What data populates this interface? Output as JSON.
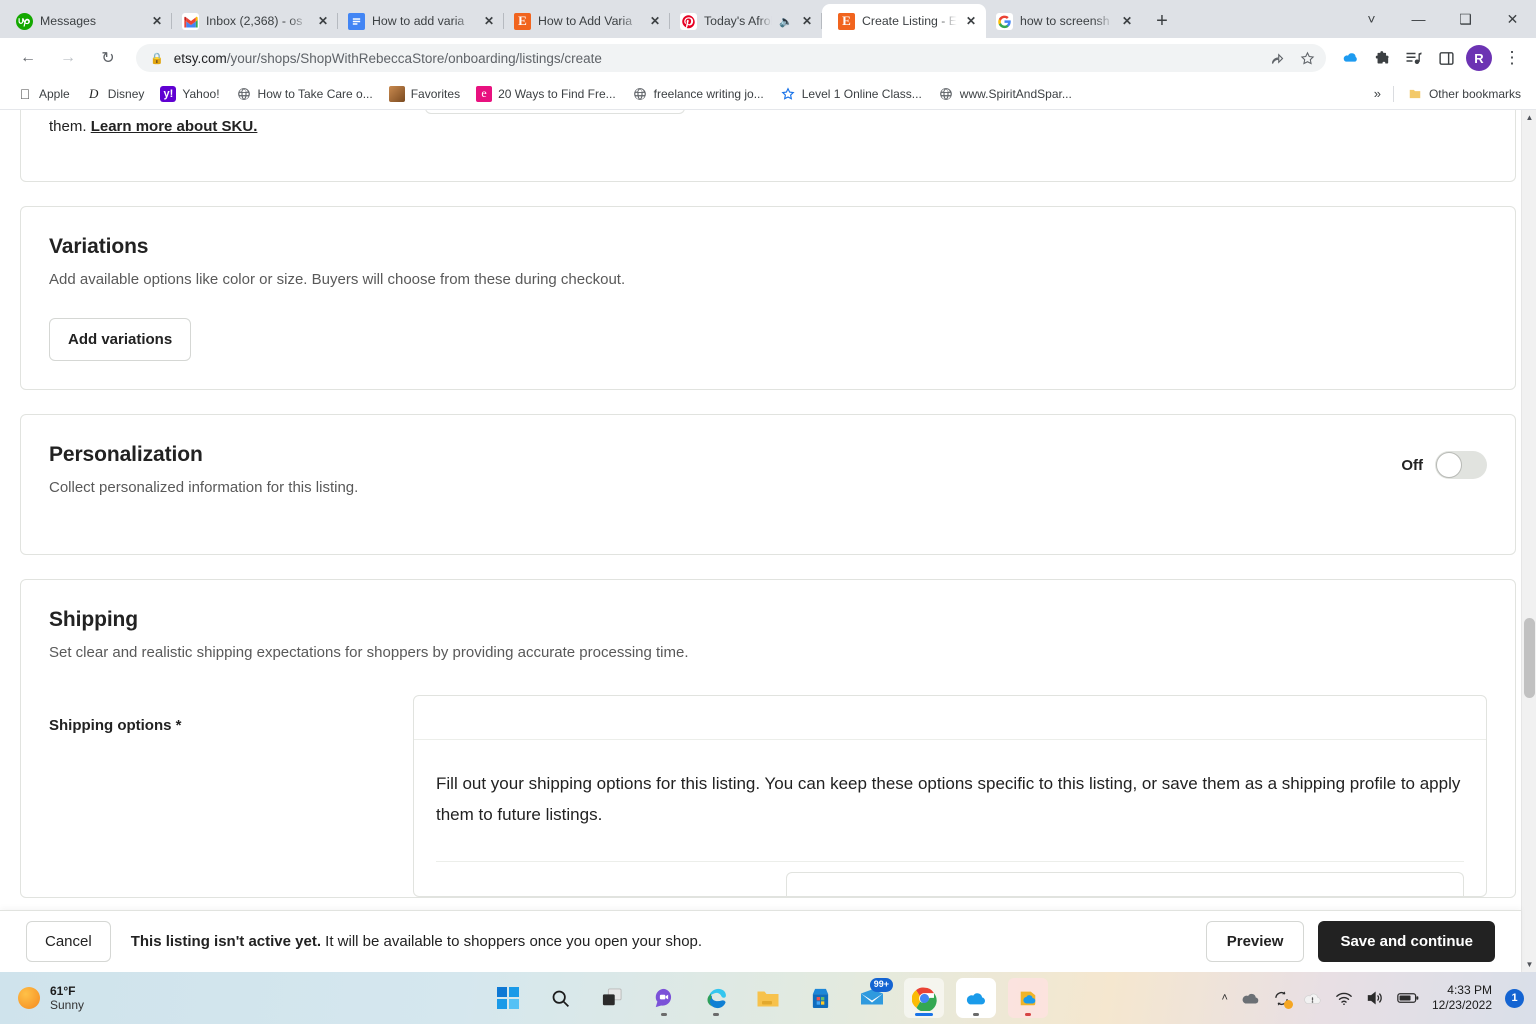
{
  "browser": {
    "tabs": [
      {
        "title": "Messages",
        "icon": "upwork-icon",
        "active": false,
        "audio": false
      },
      {
        "title": "Inbox (2,368) - os",
        "icon": "gmail-icon",
        "active": false,
        "audio": false
      },
      {
        "title": "How to add varia",
        "icon": "doc-icon",
        "active": false,
        "audio": false
      },
      {
        "title": "How to Add Varia",
        "icon": "etsy-icon",
        "active": false,
        "audio": false
      },
      {
        "title": "Today's Afrob",
        "icon": "pinterest-icon",
        "active": false,
        "audio": true
      },
      {
        "title": "Create Listing - E",
        "icon": "etsy-icon",
        "active": true,
        "audio": false
      },
      {
        "title": "how to screensh",
        "icon": "google-icon",
        "active": false,
        "audio": false
      }
    ],
    "new_tab_label": "+",
    "window_controls": [
      "tab-search-chevron",
      "minimize",
      "maximize",
      "close"
    ],
    "nav": {
      "back": "back-arrow",
      "forward": "forward-arrow",
      "reload": "reload-arrow"
    },
    "omnibox": {
      "lock": "lock-icon",
      "url_domain": "etsy.com",
      "url_path": "/your/shops/ShopWithRebeccaStore/onboarding/listings/create",
      "share_icon": "share-icon",
      "bookmark_icon": "star-icon"
    },
    "extensions": [
      "cloud-icon",
      "puzzle-icon",
      "reading-list-icon",
      "side-panel-icon"
    ],
    "profile_initial": "R",
    "menu_icon": "three-dot-menu-icon",
    "bookmarks": [
      {
        "label": "Apple",
        "icon": "apple-icon"
      },
      {
        "label": "Disney",
        "icon": "disney-icon"
      },
      {
        "label": "Yahoo!",
        "icon": "yahoo-icon"
      },
      {
        "label": "How to Take Care o...",
        "icon": "globe-icon"
      },
      {
        "label": "Favorites",
        "icon": "favorites-icon"
      },
      {
        "label": "20 Ways to Find Fre...",
        "icon": "elementor-icon"
      },
      {
        "label": "freelance writing jo...",
        "icon": "globe-icon"
      },
      {
        "label": "Level 1 Online Class...",
        "icon": "star-blue-icon"
      },
      {
        "label": "www.SpiritAndSpar...",
        "icon": "globe-icon"
      }
    ],
    "bookmarks_overflow": "»",
    "other_bookmarks": {
      "label": "Other bookmarks",
      "icon": "folder-icon"
    }
  },
  "page": {
    "sku_card": {
      "text_before_link": "them. ",
      "link_text": "Learn more about SKU."
    },
    "variations": {
      "title": "Variations",
      "subtitle": "Add available options like color or size. Buyers will choose from these during checkout.",
      "button_label": "Add variations"
    },
    "personalization": {
      "title": "Personalization",
      "subtitle": "Collect personalized information for this listing.",
      "toggle_label": "Off",
      "toggle_state": "off"
    },
    "shipping": {
      "title": "Shipping",
      "subtitle": "Set clear and realistic shipping expectations for shoppers by providing accurate processing time.",
      "options_label": "Shipping options *",
      "options_body": "Fill out your shipping options for this listing. You can keep these options specific to this listing, or save them as a shipping profile to apply them to future listings."
    }
  },
  "footer": {
    "cancel_label": "Cancel",
    "status_bold": "This listing isn't active yet.",
    "status_rest": " It will be available to shoppers once you open your shop.",
    "preview_label": "Preview",
    "save_label": "Save and continue"
  },
  "taskbar": {
    "weather": {
      "temperature": "61°F",
      "condition": "Sunny",
      "icon": "sun-icon"
    },
    "apps": [
      {
        "name": "start-button",
        "icon": "windows-icon"
      },
      {
        "name": "search-button",
        "icon": "search-icon"
      },
      {
        "name": "task-view-button",
        "icon": "task-view-icon"
      },
      {
        "name": "chat-button",
        "icon": "chat-icon"
      },
      {
        "name": "edge-button",
        "icon": "edge-icon"
      },
      {
        "name": "file-explorer-button",
        "icon": "folder-icon"
      },
      {
        "name": "microsoft-store-button",
        "icon": "store-icon"
      },
      {
        "name": "mail-button",
        "icon": "mail-icon",
        "badge": "99+"
      },
      {
        "name": "chrome-button",
        "icon": "chrome-icon"
      },
      {
        "name": "onedrive-button",
        "icon": "onedrive-icon"
      },
      {
        "name": "dropbox-button",
        "icon": "cloud-app-icon"
      }
    ],
    "tray": {
      "overflow": "show-hidden-icons-chevron",
      "icons": [
        "cloud-icon",
        "sync-icon",
        "onedrive-alert-icon",
        "wifi-icon",
        "volume-icon",
        "battery-icon"
      ],
      "time": "4:33 PM",
      "date": "12/23/2022",
      "notification_count": "1"
    }
  }
}
